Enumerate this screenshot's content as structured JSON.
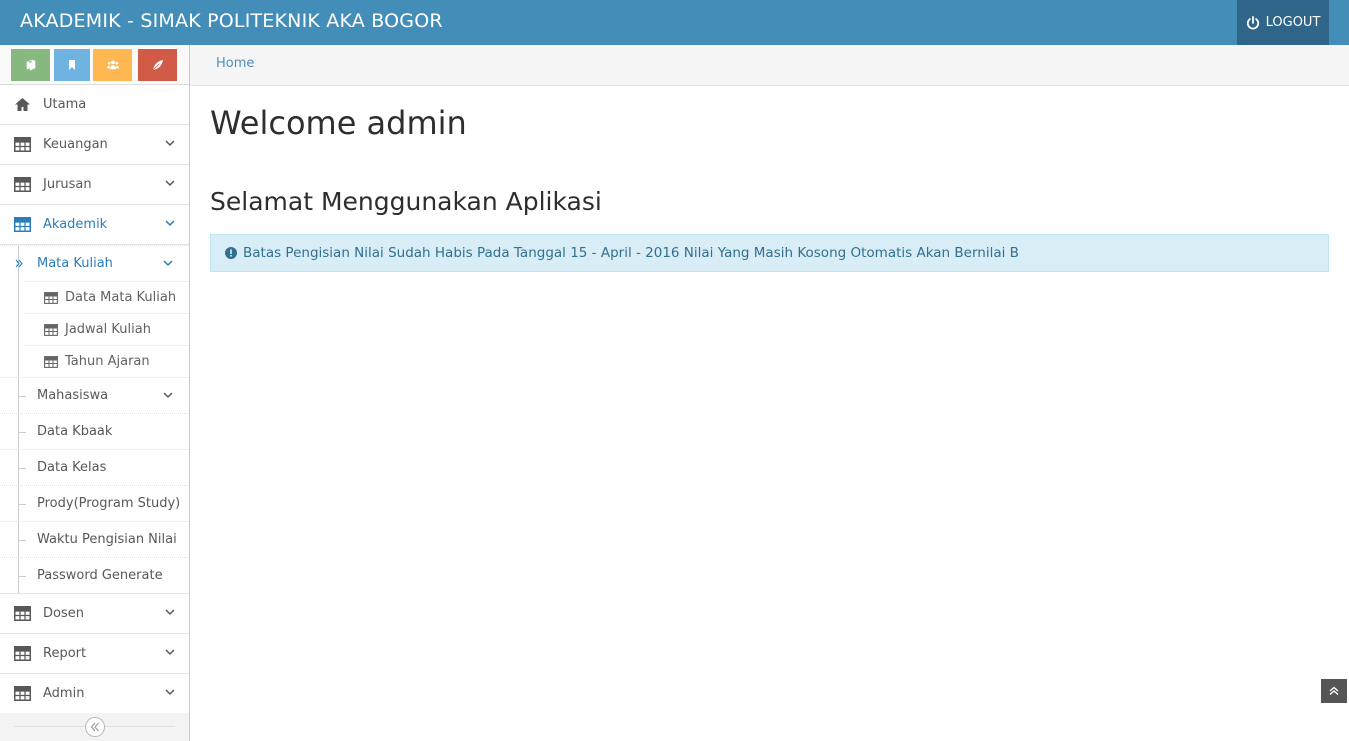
{
  "header": {
    "brand": "AKADEMIK - SIMAK POLITEKNIK AKA BOGOR",
    "logout_label": "LOGOUT"
  },
  "shortcuts": [
    {
      "icon": "book-icon",
      "color": "#87b87f"
    },
    {
      "icon": "bookmark-icon",
      "color": "#6fb3e0"
    },
    {
      "icon": "users-icon",
      "color": "#ffb752"
    },
    {
      "icon": "leaf-icon",
      "color": "#d15b47"
    }
  ],
  "sidebar": {
    "items": [
      {
        "label": "Utama",
        "icon": "home-icon"
      },
      {
        "label": "Keuangan",
        "icon": "table-icon"
      },
      {
        "label": "Jurusan",
        "icon": "table-icon"
      },
      {
        "label": "Akademik",
        "icon": "table-icon",
        "active": true
      },
      {
        "label": "Dosen",
        "icon": "table-icon"
      },
      {
        "label": "Report",
        "icon": "table-icon"
      },
      {
        "label": "Admin",
        "icon": "table-icon"
      }
    ],
    "akademik_sub": {
      "mata_kuliah": "Mata Kuliah",
      "mata_kuliah_children": [
        "Data Mata Kuliah",
        "Jadwal Kuliah",
        "Tahun Ajaran"
      ],
      "others": [
        "Mahasiswa",
        "Data Kbaak",
        "Data Kelas",
        "Prody(Program Study)",
        "Waktu Pengisian Nilai",
        "Password Generate"
      ]
    }
  },
  "breadcrumb": {
    "home": "Home"
  },
  "main": {
    "title": "Welcome admin",
    "subtitle": "Selamat Menggunakan Aplikasi",
    "alert": "Batas Pengisian Nilai Sudah Habis Pada Tanggal 15 - April - 2016 Nilai Yang Masih Kosong Otomatis Akan Bernilai B"
  },
  "colors": {
    "navbar": "#438eb9",
    "logout_bg": "#2e6589",
    "link": "#2b7dbc",
    "alert_bg": "#d9edf7",
    "alert_text": "#31708f"
  }
}
